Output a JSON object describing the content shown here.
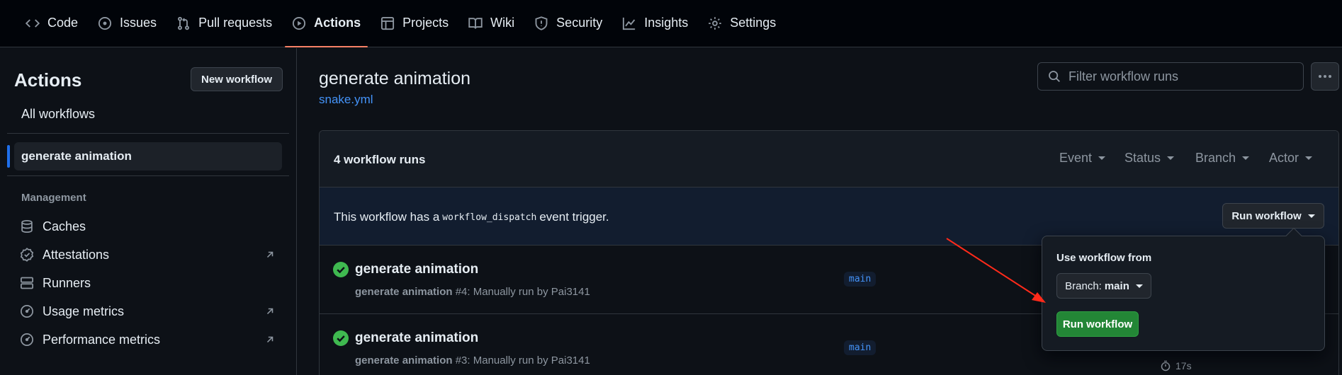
{
  "nav": {
    "tabs": [
      {
        "label": "Code",
        "icon": "code-icon"
      },
      {
        "label": "Issues",
        "icon": "issue-icon"
      },
      {
        "label": "Pull requests",
        "icon": "pull-request-icon"
      },
      {
        "label": "Actions",
        "icon": "play-icon",
        "active": true
      },
      {
        "label": "Projects",
        "icon": "table-icon"
      },
      {
        "label": "Wiki",
        "icon": "book-icon"
      },
      {
        "label": "Security",
        "icon": "shield-icon"
      },
      {
        "label": "Insights",
        "icon": "graph-icon"
      },
      {
        "label": "Settings",
        "icon": "gear-icon"
      }
    ]
  },
  "sidebar": {
    "title": "Actions",
    "new_workflow_label": "New workflow",
    "all_workflows_label": "All workflows",
    "selected_workflow": "generate animation",
    "management_label": "Management",
    "management_items": [
      {
        "label": "Caches",
        "icon": "database-icon"
      },
      {
        "label": "Attestations",
        "icon": "verified-icon",
        "external": true
      },
      {
        "label": "Runners",
        "icon": "server-icon"
      },
      {
        "label": "Usage metrics",
        "icon": "meter-icon",
        "external": true
      },
      {
        "label": "Performance metrics",
        "icon": "meter-icon",
        "external": true
      }
    ]
  },
  "main": {
    "workflow_title": "generate animation",
    "workflow_file": "snake.yml",
    "filter_placeholder": "Filter workflow runs",
    "runs_count_label": "4 workflow runs",
    "filters": [
      "Event",
      "Status",
      "Branch",
      "Actor"
    ],
    "dispatch": {
      "text_before": "This workflow has a",
      "code": "workflow_dispatch",
      "text_after": "event trigger.",
      "run_button_label": "Run workflow"
    },
    "runs": [
      {
        "title": "generate animation",
        "sub_bold": "generate animation",
        "sub_rest": " #4: Manually run by Pai3141",
        "branch": "main",
        "status": "success"
      },
      {
        "title": "generate animation",
        "sub_bold": "generate animation",
        "sub_rest": " #3: Manually run by Pai3141",
        "branch": "main",
        "status": "success",
        "duration": "17s"
      }
    ]
  },
  "popover": {
    "label": "Use workflow from",
    "branch_prefix": "Branch:",
    "branch_value": "main",
    "run_button_label": "Run workflow"
  },
  "colors": {
    "accent_tab": "#f78166",
    "link": "#4493f8",
    "success": "#3fb950",
    "primary_button": "#238636",
    "annotation_arrow": "#ff2a1a"
  }
}
